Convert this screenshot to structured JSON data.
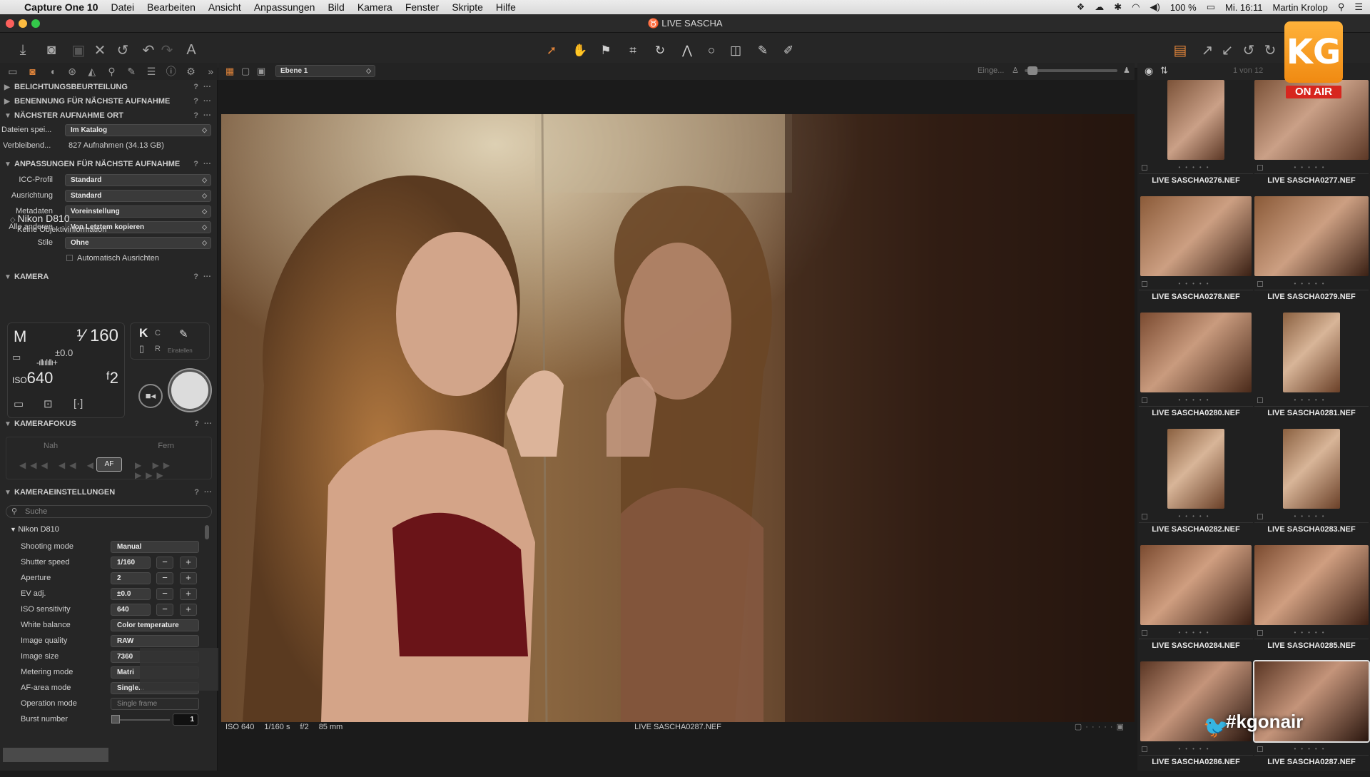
{
  "menubar": {
    "app": "Capture One 10",
    "items": [
      "Datei",
      "Bearbeiten",
      "Ansicht",
      "Anpassungen",
      "Bild",
      "Kamera",
      "Fenster",
      "Skripte",
      "Hilfe"
    ],
    "battery": "100 %",
    "clock": "Mi. 16:11",
    "user": "Martin Krolop"
  },
  "window": {
    "title": "LIVE SASCHA"
  },
  "viewer": {
    "layer": "Ebene 1",
    "proof_label": "Einge...",
    "counter": "1 von 12",
    "status": {
      "iso": "ISO 640",
      "shutter": "1/160 s",
      "aperture": "f/2",
      "focal": "85 mm",
      "filename": "LIVE SASCHA0287.NEF"
    }
  },
  "left": {
    "sections": {
      "exposure": "BELICHTUNGSBEURTEILUNG",
      "naming": "BENENNUNG FÜR NÄCHSTE AUFNAHME",
      "location": "NÄCHSTER AUFNAHME ORT",
      "adjustments": "ANPASSUNGEN FÜR NÄCHSTE AUFNAHME",
      "camera": "KAMERA",
      "focus": "KAMERAFOKUS",
      "settings": "KAMERAEINSTELLUNGEN"
    },
    "location": {
      "store_label": "Dateien spei...",
      "store_value": "Im Katalog",
      "remaining_label": "Verbleibend...",
      "remaining_value": "827 Aufnahmen (34.13 GB)"
    },
    "adjust": [
      {
        "label": "ICC-Profil",
        "value": "Standard"
      },
      {
        "label": "Ausrichtung",
        "value": "Standard"
      },
      {
        "label": "Metadaten",
        "value": "Voreinstellung"
      },
      {
        "label": "Alle anderen",
        "value": "Von Letztem kopieren"
      },
      {
        "label": "Stile",
        "value": "Ohne"
      }
    ],
    "auto_align": "Automatisch Ausrichten",
    "camera": {
      "name": "Nikon D810",
      "lens": "Keine Objektivinformation",
      "mode": "M",
      "shutter": "¹⁄ 160",
      "ev": "±0.0",
      "iso": "640",
      "fnumber": "ᶠ2",
      "wb_k": "K",
      "wb_c": "C",
      "wb_r": "R",
      "set_label": "Einstellen"
    },
    "focus": {
      "near": "Nah",
      "far": "Fern",
      "af": "AF"
    },
    "settings": {
      "search_placeholder": "Suche",
      "device": "Nikon D810",
      "rows": [
        {
          "label": "Shooting mode",
          "value": "Manual"
        },
        {
          "label": "Shutter speed",
          "value": "1/160"
        },
        {
          "label": "Aperture",
          "value": "2"
        },
        {
          "label": "EV adj.",
          "value": "±0.0"
        },
        {
          "label": "ISO sensitivity",
          "value": "640"
        },
        {
          "label": "White balance",
          "value": "Color temperature"
        },
        {
          "label": "Image quality",
          "value": "RAW"
        },
        {
          "label": "Image size",
          "value": "7360"
        },
        {
          "label": "Metering mode",
          "value": "Matri"
        },
        {
          "label": "AF-area mode",
          "value": "Single..."
        },
        {
          "label": "Operation mode",
          "value": "Single frame"
        },
        {
          "label": "Burst number",
          "value": "1"
        }
      ]
    }
  },
  "browser": {
    "thumbs": [
      "LIVE SASCHA0276.NEF",
      "LIVE SASCHA0277.NEF",
      "LIVE SASCHA0278.NEF",
      "LIVE SASCHA0279.NEF",
      "LIVE SASCHA0280.NEF",
      "LIVE SASCHA0281.NEF",
      "LIVE SASCHA0282.NEF",
      "LIVE SASCHA0283.NEF",
      "LIVE SASCHA0284.NEF",
      "LIVE SASCHA0285.NEF",
      "LIVE SASCHA0286.NEF",
      "LIVE SASCHA0287.NEF"
    ]
  },
  "overlay": {
    "logo": "KG",
    "onair": "ON AIR",
    "hashtag": "#kgonair"
  }
}
